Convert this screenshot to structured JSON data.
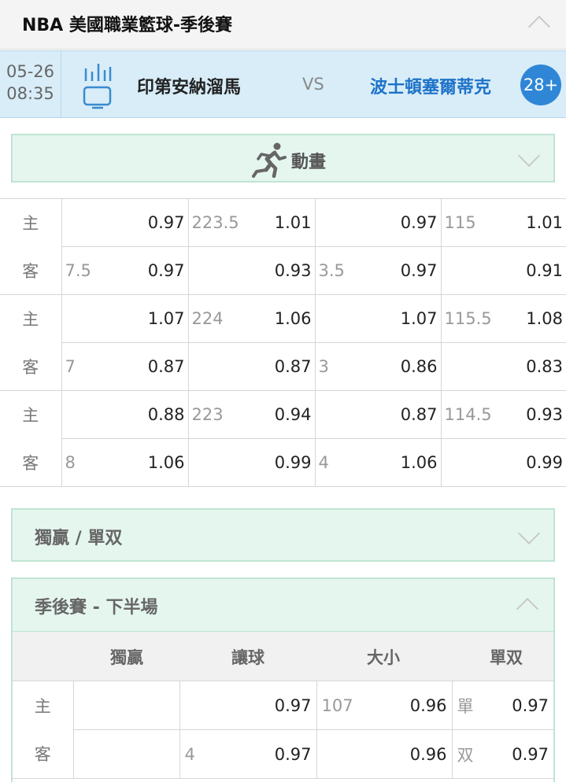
{
  "header": {
    "title": "NBA 美國職業籃球-季後賽"
  },
  "match": {
    "date": "05-26",
    "time": "08:35",
    "home_team": "印第安納溜馬",
    "vs": "VS",
    "away_team": "波士頓塞爾蒂克",
    "more_markets": "28+"
  },
  "animation": {
    "label": "動畫"
  },
  "odds_rows": [
    {
      "side": "主",
      "hcap_line": "",
      "hcap_price": "0.97",
      "total_line": "223.5",
      "total_price": "1.01",
      "hcap2_line": "",
      "hcap2_price": "0.97",
      "total2_line": "115",
      "total2_price": "1.01"
    },
    {
      "side": "客",
      "hcap_line": "7.5",
      "hcap_price": "0.97",
      "total_line": "",
      "total_price": "0.93",
      "hcap2_line": "3.5",
      "hcap2_price": "0.97",
      "total2_line": "",
      "total2_price": "0.91"
    },
    {
      "side": "主",
      "hcap_line": "",
      "hcap_price": "1.07",
      "total_line": "224",
      "total_price": "1.06",
      "hcap2_line": "",
      "hcap2_price": "1.07",
      "total2_line": "115.5",
      "total2_price": "1.08"
    },
    {
      "side": "客",
      "hcap_line": "7",
      "hcap_price": "0.87",
      "total_line": "",
      "total_price": "0.87",
      "hcap2_line": "3",
      "hcap2_price": "0.86",
      "total2_line": "",
      "total2_price": "0.83"
    },
    {
      "side": "主",
      "hcap_line": "",
      "hcap_price": "0.88",
      "total_line": "223",
      "total_price": "0.94",
      "hcap2_line": "",
      "hcap2_price": "0.87",
      "total2_line": "114.5",
      "total2_price": "0.93"
    },
    {
      "side": "客",
      "hcap_line": "8",
      "hcap_price": "1.06",
      "total_line": "",
      "total_price": "0.99",
      "hcap2_line": "4",
      "hcap2_price": "1.06",
      "total2_line": "",
      "total2_price": "0.99"
    }
  ],
  "moneyline_panel": {
    "label": "獨贏 / 單双"
  },
  "second_half": {
    "label": "季後賽 - 下半場",
    "columns": [
      "獨贏",
      "讓球",
      "大小",
      "單双"
    ],
    "rows": [
      {
        "side": "主",
        "ml": "",
        "hcap_line": "",
        "hcap_price": "0.97",
        "total_line": "107",
        "total_price": "0.96",
        "oe_label": "單",
        "oe_price": "0.97"
      },
      {
        "side": "客",
        "ml": "",
        "hcap_line": "4",
        "hcap_price": "0.97",
        "total_line": "",
        "total_price": "0.96",
        "oe_label": "双",
        "oe_price": "0.97"
      }
    ]
  }
}
